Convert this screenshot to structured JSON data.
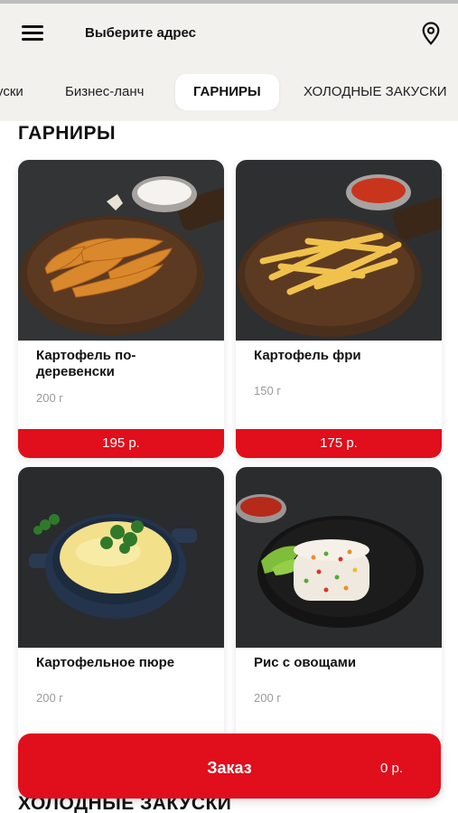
{
  "header": {
    "menu_icon": "hamburger-menu-icon",
    "address_label": "Выберите адрес",
    "location_icon": "map-pin-icon"
  },
  "tabs": [
    {
      "label": "уски"
    },
    {
      "label": "Бизнес-ланч"
    },
    {
      "label": "ГАРНИРЫ",
      "active": true
    },
    {
      "label": "ХОЛОДНЫЕ ЗАКУСКИ"
    }
  ],
  "sections": [
    {
      "title": "ГАРНИРЫ",
      "products": [
        {
          "name": "Картофель по-деревенски",
          "weight": "200 г",
          "price": "195 р."
        },
        {
          "name": "Картофель фри",
          "weight": "150 г",
          "price": "175 р."
        },
        {
          "name": "Картофельное пюре",
          "weight": "200 г"
        },
        {
          "name": "Рис с овощами",
          "weight": "200 г"
        }
      ]
    },
    {
      "title": "ХОЛОДНЫЕ ЗАКУСКИ"
    }
  ],
  "order": {
    "label": "Заказ",
    "total": "0 р."
  },
  "colors": {
    "accent": "#e10e1c",
    "background": "#f2f1ee",
    "card": "#ffffff"
  }
}
